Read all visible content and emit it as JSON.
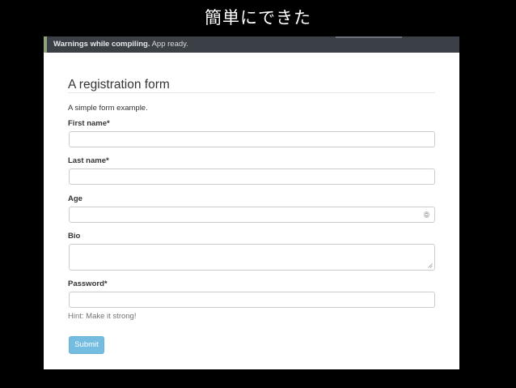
{
  "slide": {
    "title": "簡単にできた"
  },
  "status_bar": {
    "warning": "Warnings while compiling.",
    "message": "App ready."
  },
  "form": {
    "title": "A registration form",
    "description": "A simple form example.",
    "fields": [
      {
        "label": "First name*",
        "type": "text",
        "value": ""
      },
      {
        "label": "Last name*",
        "type": "text",
        "value": ""
      },
      {
        "label": "Age",
        "type": "number",
        "value": ""
      },
      {
        "label": "Bio",
        "type": "textarea",
        "value": ""
      },
      {
        "label": "Password*",
        "type": "password",
        "value": "",
        "hint": "Hint: Make it strong!"
      }
    ],
    "submit_label": "Submit"
  },
  "colors": {
    "slide_background": "#000000",
    "status_bar_background": "#3b4046",
    "status_bar_accent": "#8fa37a",
    "submit_button": "#74bde0",
    "input_border": "#cccccc"
  },
  "icons": {
    "age_spinner": "number-spinner-icon",
    "bio_resize": "resize-handle-icon"
  }
}
